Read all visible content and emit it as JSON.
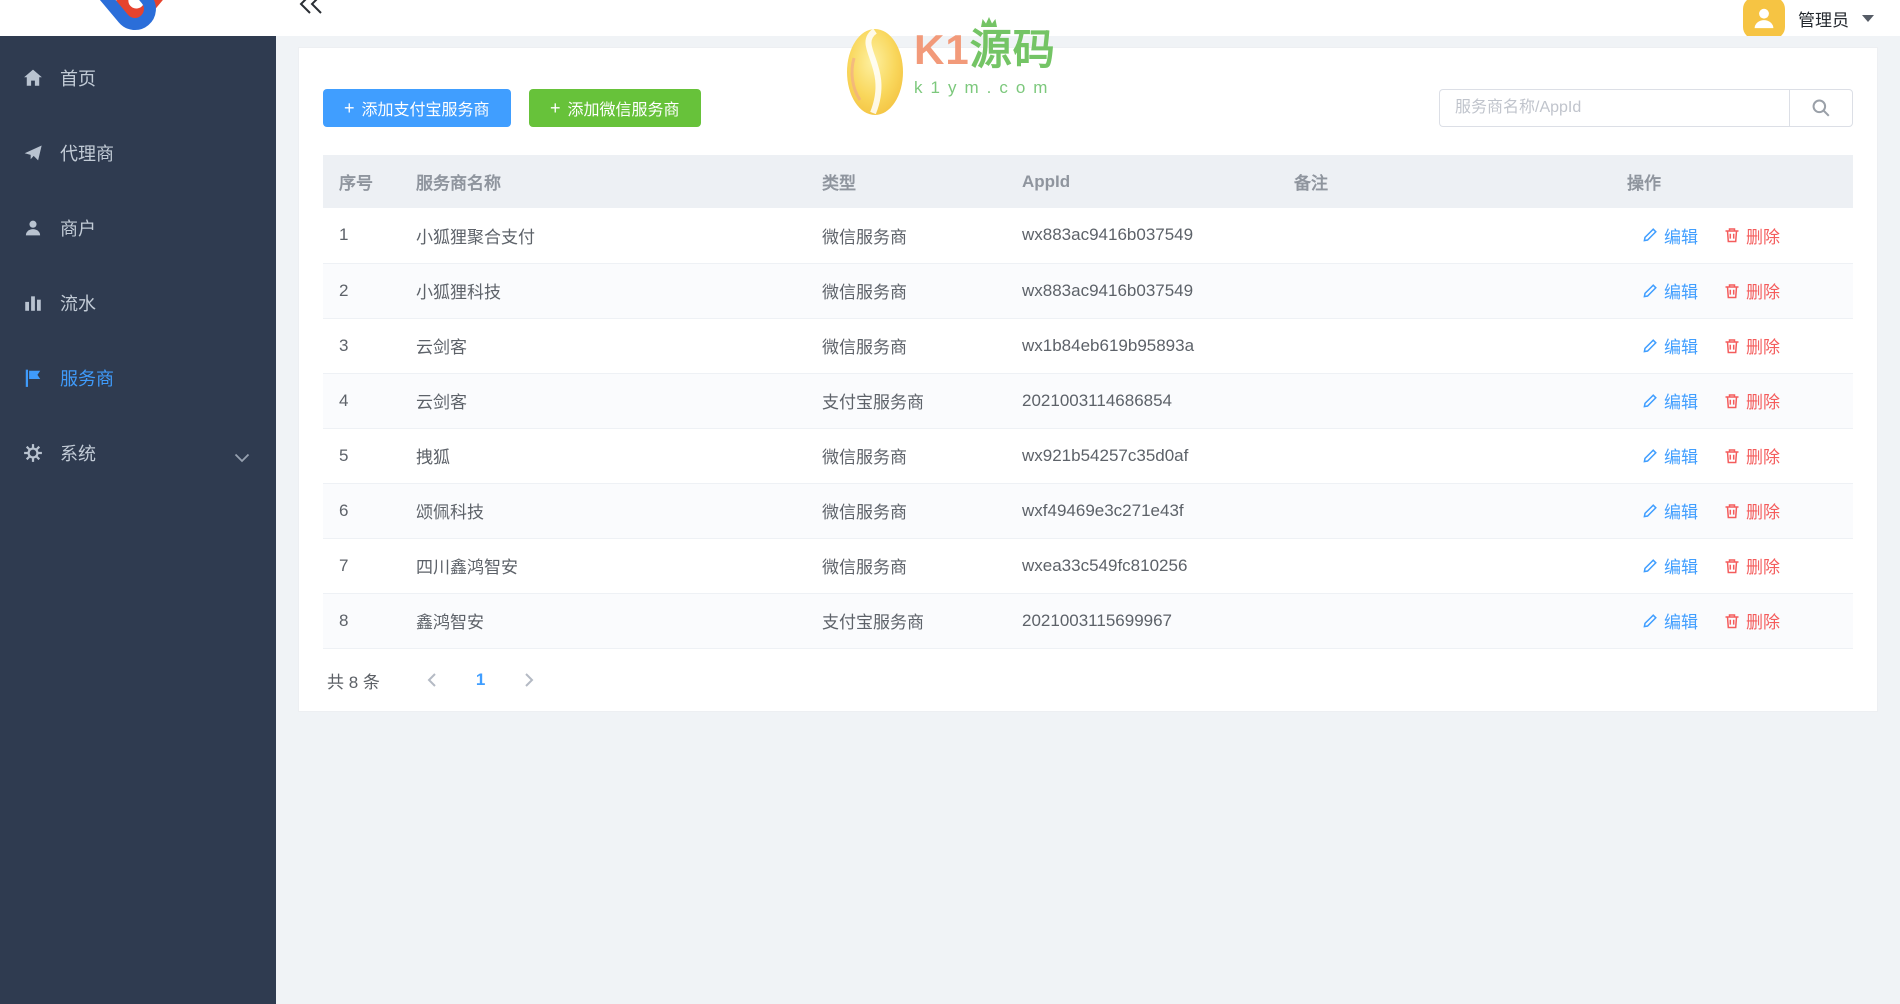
{
  "header": {
    "admin_label": "管理员"
  },
  "watermark": {
    "brand_k1": "K1",
    "brand_yuanma": "源码",
    "domain": "k1ym.com"
  },
  "sidebar": {
    "items": [
      {
        "label": "首页",
        "icon": "home-icon",
        "active": false
      },
      {
        "label": "代理商",
        "icon": "send-icon",
        "active": false
      },
      {
        "label": "商户",
        "icon": "user-icon",
        "active": false
      },
      {
        "label": "流水",
        "icon": "chart-icon",
        "active": false
      },
      {
        "label": "服务商",
        "icon": "flag-icon",
        "active": true
      },
      {
        "label": "系统",
        "icon": "gear-icon",
        "active": false,
        "has_children": true
      }
    ]
  },
  "toolbar": {
    "plus": "+",
    "add_alipay": "添加支付宝服务商",
    "add_wechat": "添加微信服务商",
    "search_placeholder": "服务商名称/AppId"
  },
  "table": {
    "columns": [
      "序号",
      "服务商名称",
      "类型",
      "AppId",
      "备注",
      "操作"
    ],
    "actions": {
      "edit": "编辑",
      "delete": "删除"
    },
    "rows": [
      {
        "index": "1",
        "name": "小狐狸聚合支付",
        "type": "微信服务商",
        "appid": "wx883ac9416b037549",
        "remark": ""
      },
      {
        "index": "2",
        "name": "小狐狸科技",
        "type": "微信服务商",
        "appid": "wx883ac9416b037549",
        "remark": ""
      },
      {
        "index": "3",
        "name": "云剑客",
        "type": "微信服务商",
        "appid": "wx1b84eb619b95893a",
        "remark": ""
      },
      {
        "index": "4",
        "name": "云剑客",
        "type": "支付宝服务商",
        "appid": "2021003114686854",
        "remark": ""
      },
      {
        "index": "5",
        "name": "拽狐",
        "type": "微信服务商",
        "appid": "wx921b54257c35d0af",
        "remark": ""
      },
      {
        "index": "6",
        "name": "颂佩科技",
        "type": "微信服务商",
        "appid": "wxf49469e3c271e43f",
        "remark": ""
      },
      {
        "index": "7",
        "name": "四川鑫鸿智安",
        "type": "微信服务商",
        "appid": "wxea33c549fc810256",
        "remark": ""
      },
      {
        "index": "8",
        "name": "鑫鸿智安",
        "type": "支付宝服务商",
        "appid": "2021003115699967",
        "remark": ""
      }
    ]
  },
  "pagination": {
    "total": "共 8 条",
    "page": "1"
  },
  "colors": {
    "accent_blue": "#409eff",
    "accent_green": "#67c23a",
    "danger_red": "#f45c5c",
    "sidebar_bg": "#2f3b50",
    "main_bg": "#f0f3f6",
    "thead_bg": "#edf0f4"
  }
}
